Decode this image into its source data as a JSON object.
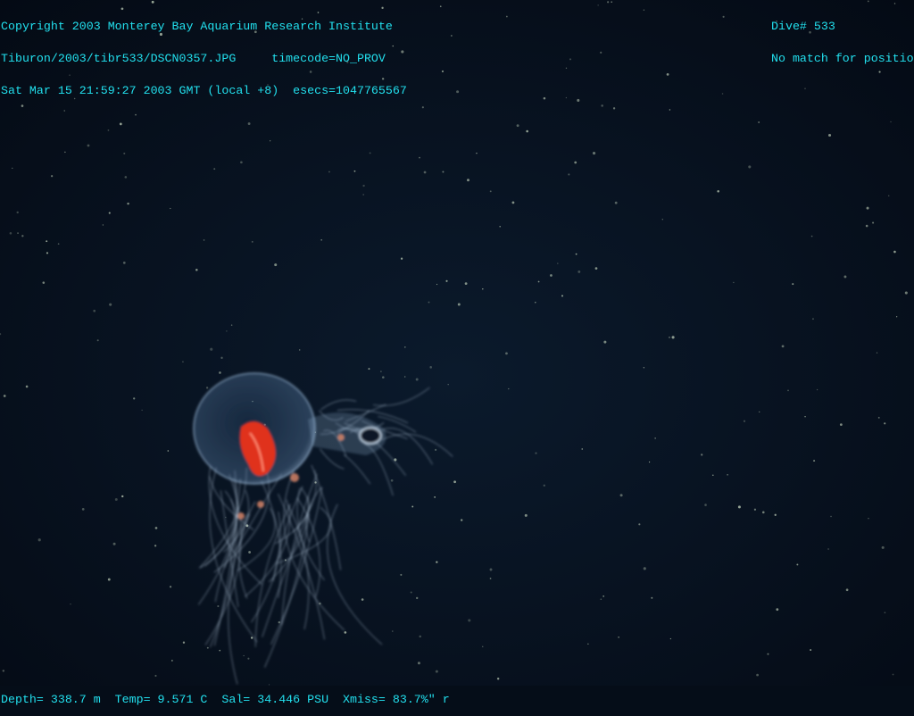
{
  "overlay": {
    "top_left": [
      "Copyright 2003 Monterey Bay Aquarium Research Institute",
      "Tiburon/2003/tibr533/DSCN0357.JPG     timecode=NO_PROV",
      "Sat Mar 15 21:59:27 2003 GMT (local +8)  esecs=1047765567"
    ],
    "top_right": [
      "Dive# 533",
      "No match for positio"
    ],
    "bottom": "Depth= 338.7 m  Temp= 9.571 C  Sal= 34.446 PSU  Xmiss= 83.7%\" r"
  },
  "colors": {
    "text": "#22e0ee",
    "water": "#050d18",
    "gonad": "#e0301c"
  }
}
